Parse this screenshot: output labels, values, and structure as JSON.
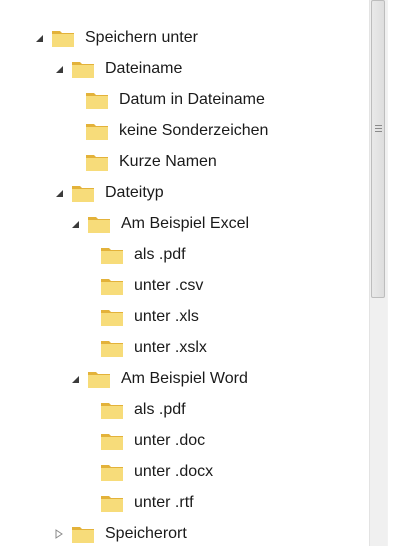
{
  "tree": {
    "items": [
      {
        "label": "Speichern unter"
      },
      {
        "label": "Dateiname"
      },
      {
        "label": "Datum in Dateiname"
      },
      {
        "label": "keine Sonderzeichen"
      },
      {
        "label": "Kurze Namen"
      },
      {
        "label": "Dateityp"
      },
      {
        "label": "Am Beispiel Excel"
      },
      {
        "label": "als .pdf"
      },
      {
        "label": "unter .csv"
      },
      {
        "label": "unter .xls"
      },
      {
        "label": "unter .xslx"
      },
      {
        "label": "Am Beispiel Word"
      },
      {
        "label": "als .pdf"
      },
      {
        "label": "unter .doc"
      },
      {
        "label": "unter .docx"
      },
      {
        "label": "unter .rtf"
      },
      {
        "label": "Speicherort"
      }
    ]
  },
  "icons": {
    "expanded": "triangle-down-icon",
    "collapsed": "triangle-right-icon",
    "folder": "folder-icon"
  },
  "colors": {
    "folder_light": "#f7dc7a",
    "folder_dark": "#e3b23a",
    "text": "#1a1a1a",
    "expander": "#3b3b3b"
  }
}
